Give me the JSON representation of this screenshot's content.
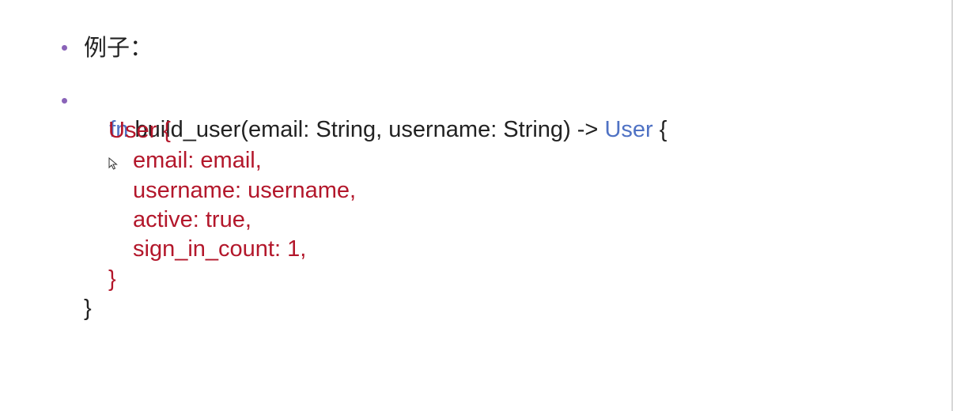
{
  "slide": {
    "example_label": "例子：",
    "code": {
      "signature": {
        "keyword": "fn",
        "middle": " build_user(email: String, username: String) -> ",
        "return_type": "User",
        "open_brace": " {"
      },
      "struct_open": "User {",
      "fields": [
        "email: email,",
        "username: username,",
        "active: true,",
        "sign_in_count: 1,"
      ],
      "struct_close": "}",
      "fn_close": "}"
    }
  },
  "colors": {
    "bullet": "#8a63b8",
    "keyword": "#4f72c4",
    "struct_literal": "#b3172b",
    "text": "#222222",
    "title_partial": "#7d4fa6"
  },
  "icons": {
    "cursor": "mouse-pointer-icon"
  }
}
